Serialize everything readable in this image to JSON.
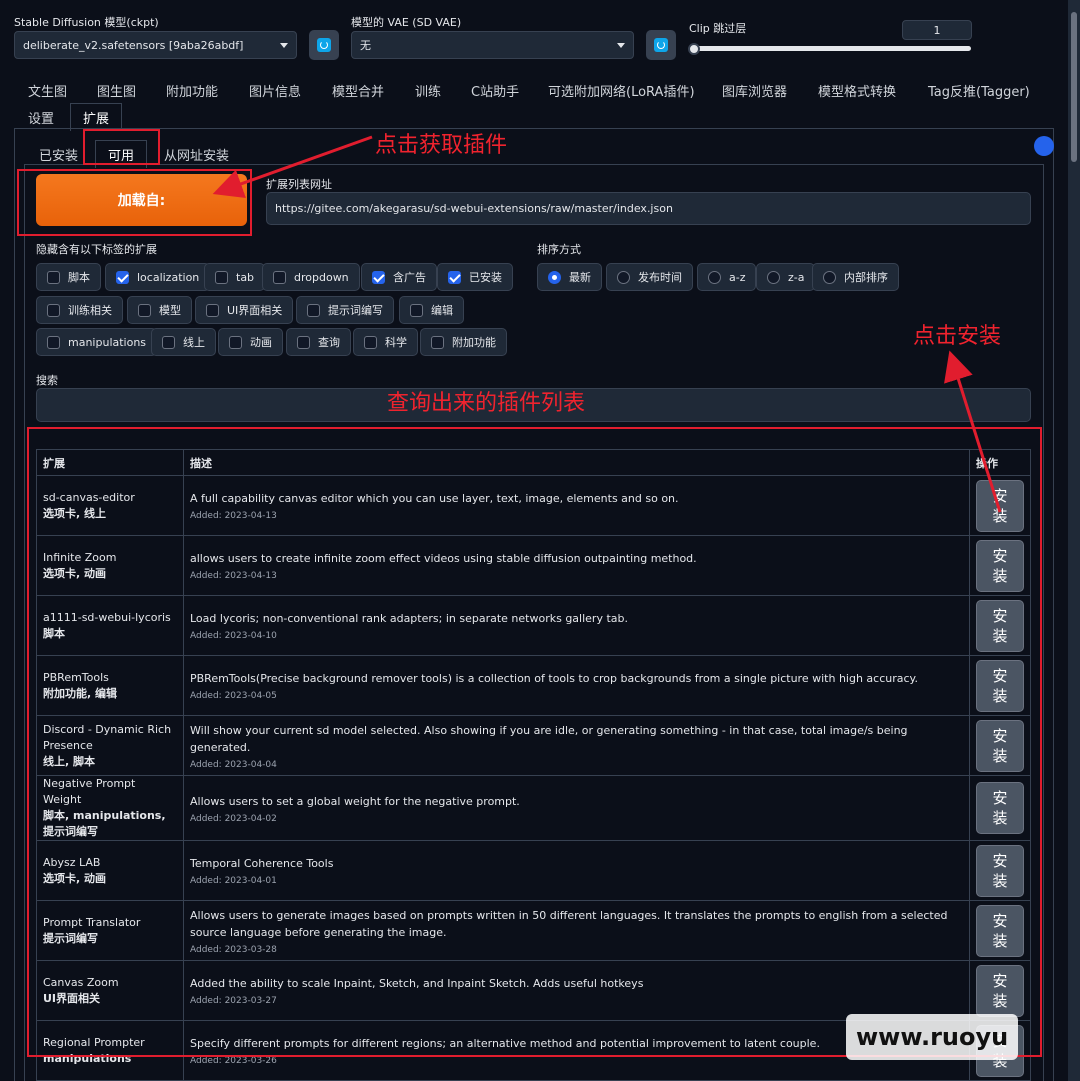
{
  "header": {
    "ckpt_label": "Stable Diffusion 模型(ckpt)",
    "ckpt_value": "deliberate_v2.safetensors [9aba26abdf]",
    "vae_label": "模型的 VAE (SD VAE)",
    "vae_value": "无",
    "clip_label": "Clip 跳过层",
    "clip_value": "1",
    "clip_level": 0
  },
  "main_tabs": [
    "文生图",
    "图生图",
    "附加功能",
    "图片信息",
    "模型合并",
    "训练",
    "C站助手",
    "可选附加网络(LoRA插件)",
    "图库浏览器",
    "模型格式转换",
    "Tag反推(Tagger)"
  ],
  "main_tabs_row2": [
    "设置",
    "扩展"
  ],
  "sub_tabs": [
    "已安装",
    "可用",
    "从网址安装"
  ],
  "load_button": "加载自:",
  "index_url_label": "扩展列表网址",
  "index_url": "https://gitee.com/akegarasu/sd-webui-extensions/raw/master/index.json",
  "hide_label": "隐藏含有以下标签的扩展",
  "hide_tags": [
    {
      "label": "脚本",
      "checked": false
    },
    {
      "label": "localization",
      "checked": true
    },
    {
      "label": "tab",
      "checked": false
    },
    {
      "label": "dropdown",
      "checked": false
    },
    {
      "label": "含广告",
      "checked": true
    },
    {
      "label": "已安装",
      "checked": true
    },
    {
      "label": "训练相关",
      "checked": false
    },
    {
      "label": "模型",
      "checked": false
    },
    {
      "label": "UI界面相关",
      "checked": false
    },
    {
      "label": "提示词编写",
      "checked": false
    },
    {
      "label": "编辑",
      "checked": false
    },
    {
      "label": "manipulations",
      "checked": false
    },
    {
      "label": "线上",
      "checked": false
    },
    {
      "label": "动画",
      "checked": false
    },
    {
      "label": "查询",
      "checked": false
    },
    {
      "label": "科学",
      "checked": false
    },
    {
      "label": "附加功能",
      "checked": false
    }
  ],
  "sort_label": "排序方式",
  "sort_options": [
    {
      "label": "最新",
      "checked": true
    },
    {
      "label": "发布时间",
      "checked": false
    },
    {
      "label": "a-z",
      "checked": false
    },
    {
      "label": "z-a",
      "checked": false
    },
    {
      "label": "内部排序",
      "checked": false
    }
  ],
  "search_label": "搜索",
  "annotations": {
    "get_plugins": "点击获取插件",
    "click_install": "点击安装",
    "list_caption": "查询出来的插件列表"
  },
  "table": {
    "headers": [
      "扩展",
      "描述",
      "操作"
    ],
    "install_label": "安\n装",
    "rows": [
      {
        "name": "sd-canvas-editor",
        "tags": "选项卡, 线上",
        "desc": "A full capability canvas editor which you can use layer, text, image, elements and so on.",
        "added": "Added: 2023-04-13"
      },
      {
        "name": "Infinite Zoom",
        "tags": "选项卡, 动画",
        "desc": "allows users to create infinite zoom effect videos using stable diffusion outpainting method.",
        "added": "Added: 2023-04-13"
      },
      {
        "name": "a1111-sd-webui-lycoris",
        "tags": "脚本",
        "desc": "Load lycoris; non-conventional rank adapters; in separate networks gallery tab.",
        "added": "Added: 2023-04-10"
      },
      {
        "name": "PBRemTools",
        "tags": "附加功能, 编辑",
        "desc": "PBRemTools(Precise background remover tools) is a collection of tools to crop backgrounds from a single picture with high accuracy.",
        "added": "Added: 2023-04-05"
      },
      {
        "name": "Discord - Dynamic Rich Presence",
        "tags": "线上, 脚本",
        "desc": "Will show your current sd model selected. Also showing if you are idle, or generating something - in that case, total image/s being generated.",
        "added": "Added: 2023-04-04"
      },
      {
        "name": "Negative Prompt Weight",
        "tags": "脚本, manipulations, 提示词编写",
        "desc": "Allows users to set a global weight for the negative prompt.",
        "added": "Added: 2023-04-02"
      },
      {
        "name": "Abysz LAB",
        "tags": "选项卡, 动画",
        "desc": "Temporal Coherence Tools",
        "added": "Added: 2023-04-01"
      },
      {
        "name": "Prompt Translator",
        "tags": "提示词编写",
        "desc": "Allows users to generate images based on prompts written in 50 different languages. It translates the prompts to english from a selected source language before generating the image.",
        "added": "Added: 2023-03-28"
      },
      {
        "name": "Canvas Zoom",
        "tags": "UI界面相关",
        "desc": "Added the ability to scale Inpaint, Sketch, and Inpaint Sketch. Adds useful hotkeys",
        "added": "Added: 2023-03-27"
      },
      {
        "name": "Regional Prompter",
        "tags": "manipulations",
        "desc": "Specify different prompts for different regions; an alternative method and potential improvement to latent couple.",
        "added": "Added: 2023-03-26"
      }
    ]
  },
  "watermark": "www.ruoyu",
  "colors": {
    "accent_orange": "#f06b10",
    "annotation_red": "#e11d2e",
    "bg": "#0b0f19"
  }
}
